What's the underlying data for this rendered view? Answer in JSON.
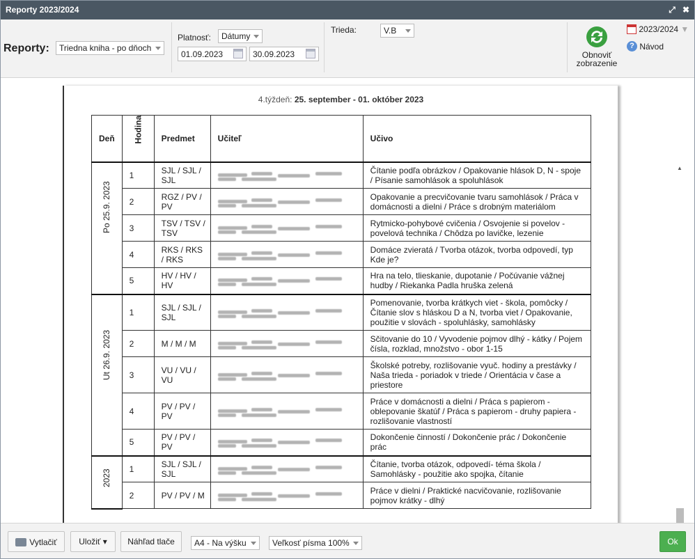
{
  "window": {
    "title": "Reporty 2023/2024",
    "restore_icon": "⤢",
    "close_icon": "✖"
  },
  "toolbar": {
    "reporty_label": "Reporty:",
    "report_type": "Triedna kniha - po dňoch",
    "platnost_label": "Platnosť:",
    "platnost_value": "Dátumy",
    "date_from": "01.09.2023",
    "date_to": "30.09.2023",
    "trieda_label": "Trieda:",
    "trieda_value": "V.B",
    "refresh_label_1": "Obnoviť",
    "refresh_label_2": "zobrazenie",
    "year": "2023/2024",
    "help": "Návod"
  },
  "report": {
    "week_prefix": "4.týždeň:",
    "week_range": "25. september - 01. október 2023",
    "columns": [
      "Deň",
      "Hodina",
      "Predmet",
      "Učiteľ",
      "Učivo"
    ],
    "days": [
      {
        "label": "Po 25.9. 2023",
        "lessons": [
          {
            "num": "1",
            "subject": "SJL / SJL / SJL",
            "topic": "Čítanie podľa obrázkov / Opakovanie hlások D, N - spoje / Písanie samohlások a spoluhlások"
          },
          {
            "num": "2",
            "subject": "RGZ / PV / PV",
            "topic": "Opakovanie a precvičovanie tvaru samohlások / Práca v domácnosti a dielni / Práce s drobným materiálom"
          },
          {
            "num": "3",
            "subject": "TSV / TSV / TSV",
            "topic": "Rytmicko-pohybové cvičenia / Osvojenie si povelov - povelová technika / Chôdza po lavičke, lezenie"
          },
          {
            "num": "4",
            "subject": "RKS / RKS / RKS",
            "topic": "Domáce zvieratá / Tvorba otázok, tvorba odpovedí, typ Kde je?"
          },
          {
            "num": "5",
            "subject": "HV / HV / HV",
            "topic": "Hra na telo, tlieskanie, dupotanie / Počúvanie vážnej hudby / Riekanka Padla hruška zelená"
          }
        ]
      },
      {
        "label": "Ut 26.9. 2023",
        "lessons": [
          {
            "num": "1",
            "subject": "SJL / SJL / SJL",
            "topic": "Pomenovanie, tvorba krátkych viet - škola, pomôcky / Čítanie slov s hláskou D a N, tvorba viet / Opakovanie, použitie v slovách - spoluhlásky, samohlásky"
          },
          {
            "num": "2",
            "subject": "M / M / M",
            "topic": "Sčitovanie do 10 / Vyvodenie pojmov dlhý - kátky / Pojem čísla, rozklad, množstvo - obor 1-15"
          },
          {
            "num": "3",
            "subject": "VU / VU / VU",
            "topic": "Školské potreby, rozlišovanie vyuč. hodiny a prestávky / Naša trieda - poriadok v triede / Orientácia v čase a priestore"
          },
          {
            "num": "4",
            "subject": "PV / PV / PV",
            "topic": "Práce v domácnosti a dielni / Práca s papierom - oblepovanie škatúľ / Práca s papierom - druhy papiera - rozlišovanie vlastností"
          },
          {
            "num": "5",
            "subject": "PV / PV / PV",
            "topic": "Dokončenie činností / Dokončenie prác / Dokončenie prác"
          }
        ]
      },
      {
        "label": "2023",
        "lessons": [
          {
            "num": "1",
            "subject": "SJL / SJL / SJL",
            "topic": "Čítanie, tvorba otázok, odpovedí- téma škola / Samohlásky - použitie ako spojka, čítanie"
          },
          {
            "num": "2",
            "subject": "PV / PV / M",
            "topic": "Práce v dielni / Praktické nacvičovanie, rozlišovanie pojmov krátky - dlhý"
          }
        ]
      }
    ]
  },
  "footer": {
    "print": "Vytlačiť",
    "save": "Uložiť ▾",
    "preview": "Náhľad tlače",
    "paper": "A4 - Na výšku",
    "font_size": "Veľkosť písma 100%",
    "ok": "Ok"
  },
  "colors": {
    "titlebar": "#4a5763",
    "ok_button": "#4caf50",
    "refresh_icon": "#3aa040"
  }
}
